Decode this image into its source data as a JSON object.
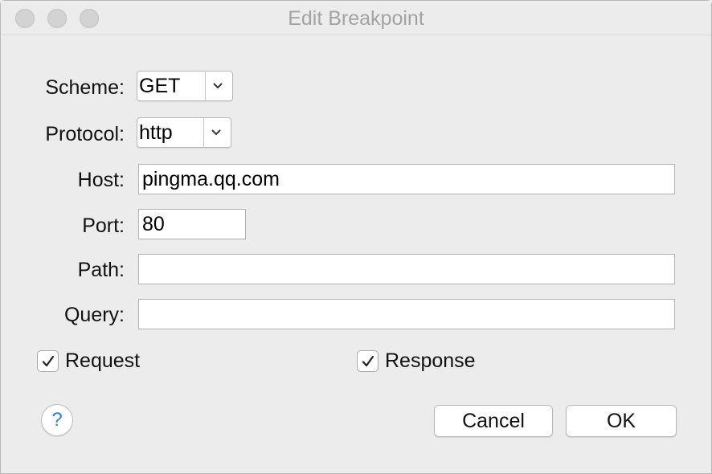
{
  "window": {
    "title": "Edit Breakpoint"
  },
  "form": {
    "scheme": {
      "label": "Scheme:",
      "value": "GET"
    },
    "protocol": {
      "label": "Protocol:",
      "value": "http"
    },
    "host": {
      "label": "Host:",
      "value": "pingma.qq.com"
    },
    "port": {
      "label": "Port:",
      "value": "80"
    },
    "path": {
      "label": "Path:",
      "value": ""
    },
    "query": {
      "label": "Query:",
      "value": ""
    }
  },
  "options": {
    "request": {
      "label": "Request",
      "checked": true
    },
    "response": {
      "label": "Response",
      "checked": true
    }
  },
  "buttons": {
    "help": "?",
    "cancel": "Cancel",
    "ok": "OK"
  },
  "icons": {
    "popup_arrow": "chevron-down-icon",
    "check": "checkmark-icon"
  },
  "colors": {
    "help_accent": "#2f7de1",
    "title_text": "#a3a3a3"
  }
}
